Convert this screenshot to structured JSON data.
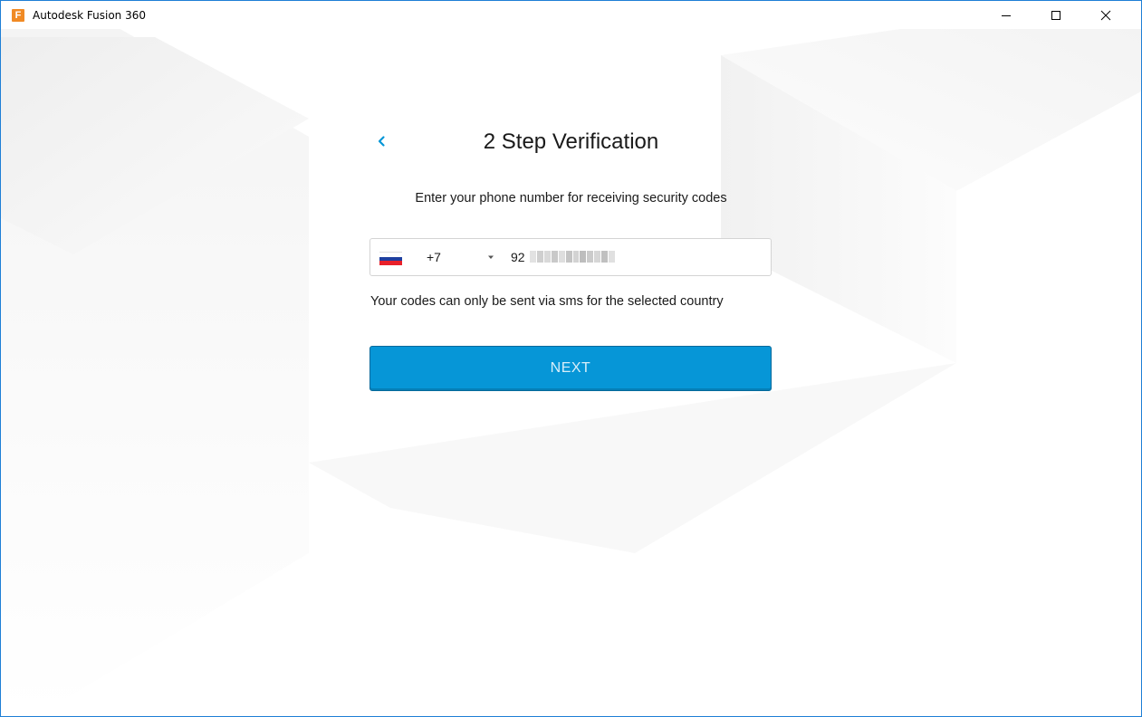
{
  "window": {
    "app_title": "Autodesk Fusion 360",
    "app_icon_letter": "F",
    "controls": [
      "minimize-icon",
      "maximize-icon",
      "close-icon"
    ]
  },
  "verification": {
    "title": "2 Step Verification",
    "back_icon": "chevron-left-icon",
    "instruction": "Enter your phone number for receiving security codes",
    "phone": {
      "country_flag": "russia-flag-icon",
      "country_code": "+7",
      "number_visible_prefix": "92",
      "number_obscured": true,
      "dropdown_icon": "caret-down-icon"
    },
    "note": "Your codes can only be sent via sms for the selected country",
    "next_label": "NEXT"
  },
  "colors": {
    "accent": "#0696d7",
    "accent_border": "#04699b",
    "window_border": "#1e7fd6",
    "app_icon": "#f08a24"
  }
}
